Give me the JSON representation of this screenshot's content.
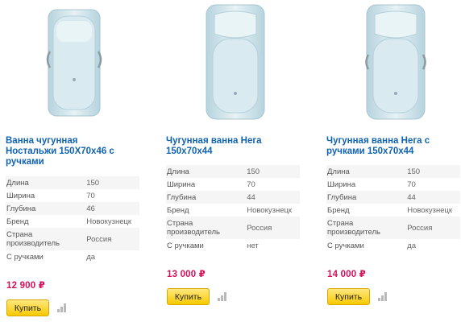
{
  "products": [
    {
      "title_lines": [
        "Ванна чугунная",
        "Ностальжи 150Х70х46 с",
        "ручками"
      ],
      "specs": [
        {
          "label": "Длина",
          "value": "150"
        },
        {
          "label": "Ширина",
          "value": "70"
        },
        {
          "label": "Глубина",
          "value": "46"
        },
        {
          "label": "Бренд",
          "value": "Новокузнецк"
        },
        {
          "label_lines": [
            "Страна",
            "производитель"
          ],
          "value": "Россия"
        },
        {
          "label": "С ручками",
          "value": "да"
        }
      ],
      "price": "12 900 ₽",
      "buy_label": "Купить",
      "icons": {
        "product_image": "bathtub-with-handles-image",
        "compare": "compare-bars-icon"
      }
    },
    {
      "title_lines": [
        "Чугунная ванна Нега",
        "150х70х44"
      ],
      "specs": [
        {
          "label": "Длина",
          "value": "150"
        },
        {
          "label": "Ширина",
          "value": "70"
        },
        {
          "label": "Глубина",
          "value": "44"
        },
        {
          "label": "Бренд",
          "value": "Новокузнецк"
        },
        {
          "label_lines": [
            "Страна",
            "производитель"
          ],
          "value": "Россия"
        },
        {
          "label": "С ручками",
          "value": "нет"
        }
      ],
      "price": "13 000 ₽",
      "buy_label": "Купить",
      "icons": {
        "product_image": "bathtub-image",
        "compare": "compare-bars-icon"
      }
    },
    {
      "title_lines": [
        "Чугунная ванна Нега с",
        "ручками 150х70х44"
      ],
      "specs": [
        {
          "label": "Длина",
          "value": "150"
        },
        {
          "label": "Ширина",
          "value": "70"
        },
        {
          "label": "Глубина",
          "value": "44"
        },
        {
          "label": "Бренд",
          "value": "Новокузнецк"
        },
        {
          "label_lines": [
            "Страна",
            "производитель"
          ],
          "value": "Россия"
        },
        {
          "label": "С ручками",
          "value": "да"
        }
      ],
      "price": "14 000 ₽",
      "buy_label": "Купить",
      "icons": {
        "product_image": "bathtub-with-handles-image",
        "compare": "compare-bars-icon"
      }
    }
  ],
  "colors": {
    "title": "#1163b0",
    "price": "#d6105b",
    "button": "#f6c900",
    "tub": "#cfe5ec"
  }
}
